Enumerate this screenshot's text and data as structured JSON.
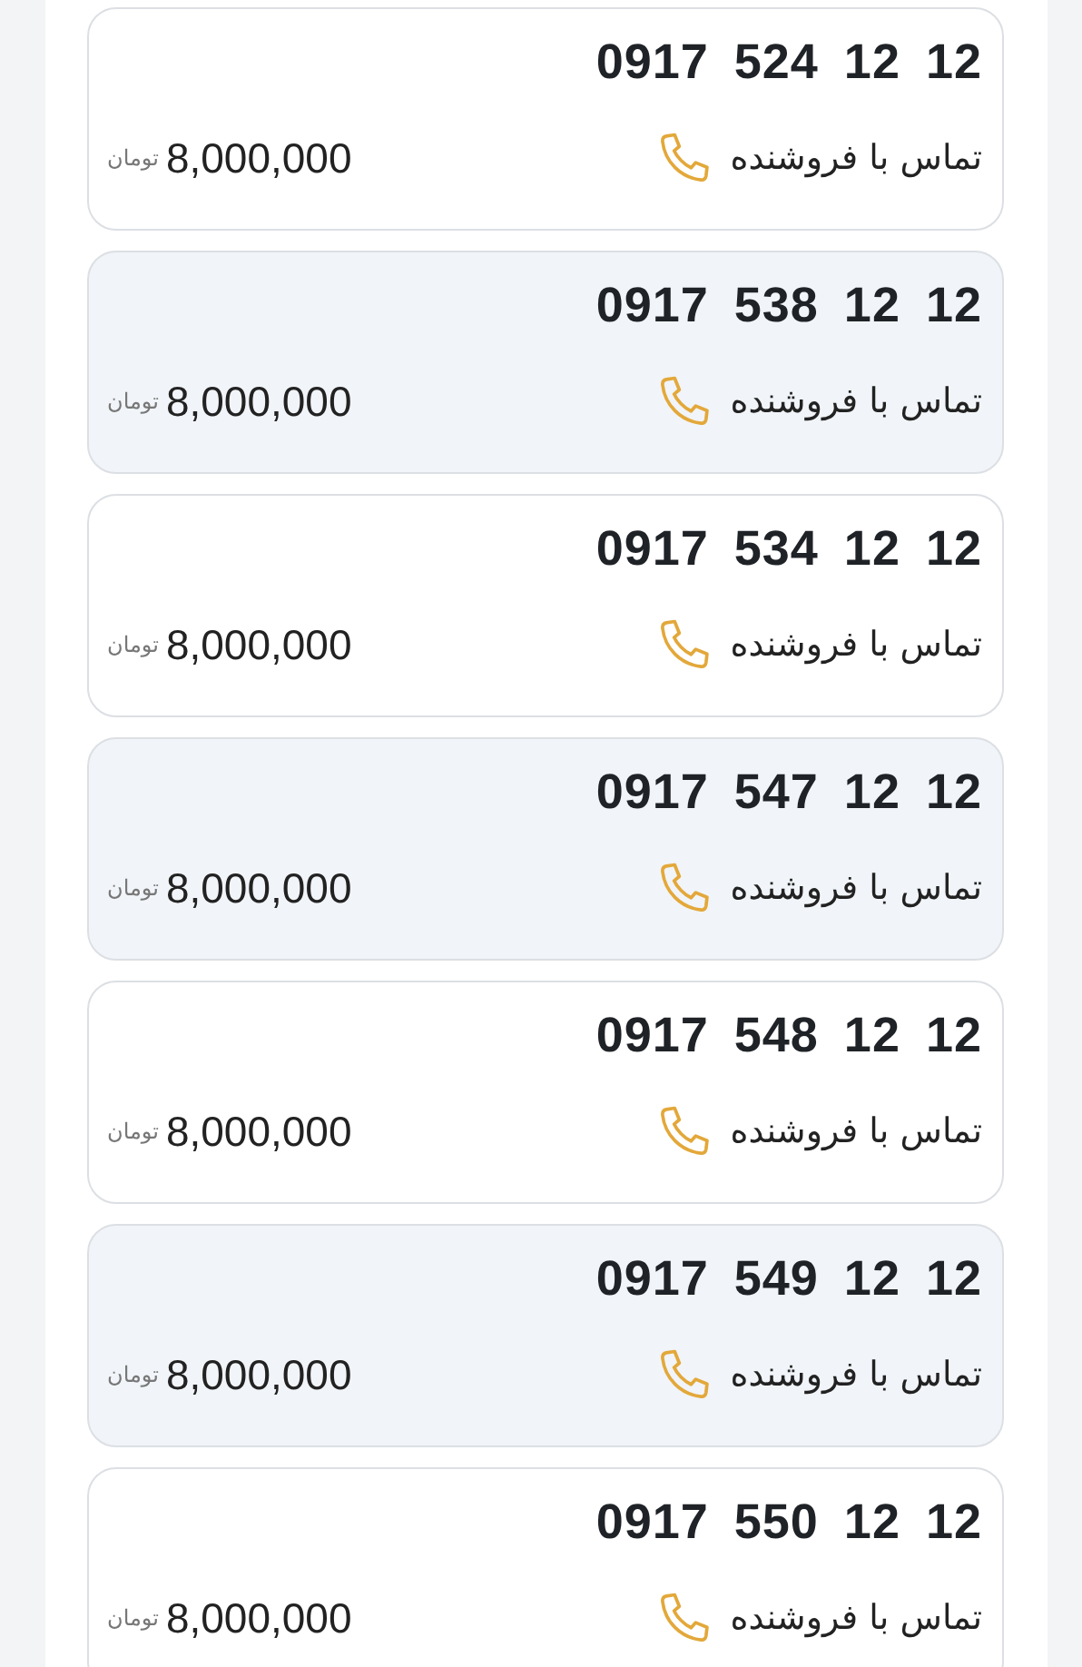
{
  "listings": [
    {
      "number": "0917 524 12 12",
      "contact": "تماس با فروشنده",
      "price": "8,000,000",
      "currency": "تومان"
    },
    {
      "number": "0917 538 12 12",
      "contact": "تماس با فروشنده",
      "price": "8,000,000",
      "currency": "تومان"
    },
    {
      "number": "0917 534 12 12",
      "contact": "تماس با فروشنده",
      "price": "8,000,000",
      "currency": "تومان"
    },
    {
      "number": "0917 547 12 12",
      "contact": "تماس با فروشنده",
      "price": "8,000,000",
      "currency": "تومان"
    },
    {
      "number": "0917 548 12 12",
      "contact": "تماس با فروشنده",
      "price": "8,000,000",
      "currency": "تومان"
    },
    {
      "number": "0917 549 12 12",
      "contact": "تماس با فروشنده",
      "price": "8,000,000",
      "currency": "تومان"
    },
    {
      "number": "0917 550 12 12",
      "contact": "تماس با فروشنده",
      "price": "8,000,000",
      "currency": "تومان"
    }
  ]
}
